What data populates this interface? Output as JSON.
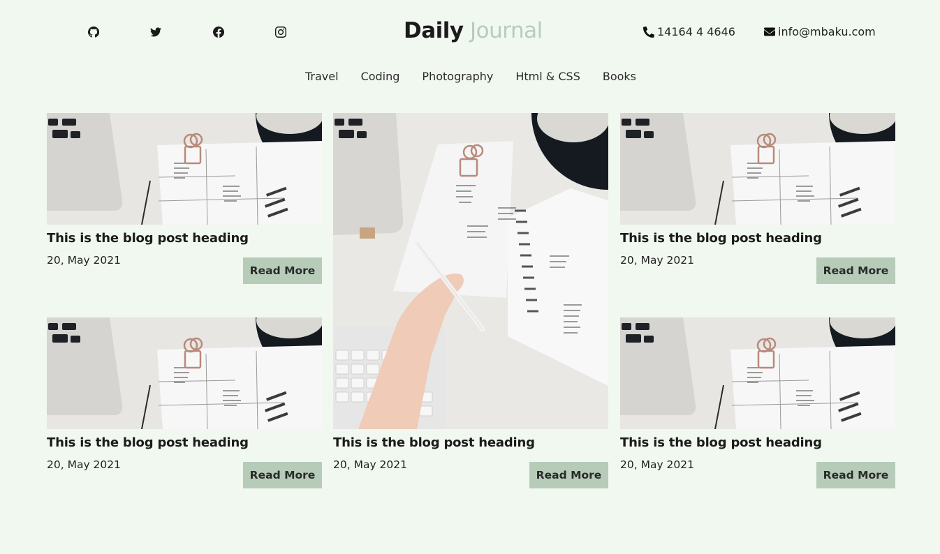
{
  "header": {
    "social": [
      "github-icon",
      "twitter-icon",
      "facebook-icon",
      "instagram-icon"
    ],
    "logo_bold": "Daily",
    "logo_light": "Journal",
    "phone": "14164 4 4646",
    "email": "info@mbaku.com"
  },
  "nav": [
    "Travel",
    "Coding",
    "Photography",
    "Html & CSS",
    "Books"
  ],
  "posts": [
    {
      "title": "This is the blog post heading",
      "date": "20, May 2021",
      "button": "Read More"
    },
    {
      "title": "This is the blog post heading",
      "date": "20, May 2021",
      "button": "Read More"
    },
    {
      "title": "This is the blog post heading",
      "date": "20, May 2021",
      "button": "Read More"
    },
    {
      "title": "This is the blog post heading",
      "date": "20, May 2021",
      "button": "Read More"
    },
    {
      "title": "This is the blog post heading",
      "date": "20, May 2021",
      "button": "Read More"
    }
  ],
  "colors": {
    "background": "#f1f8ef",
    "button": "#b6ccb9",
    "logo_light": "#b9cbbb"
  }
}
